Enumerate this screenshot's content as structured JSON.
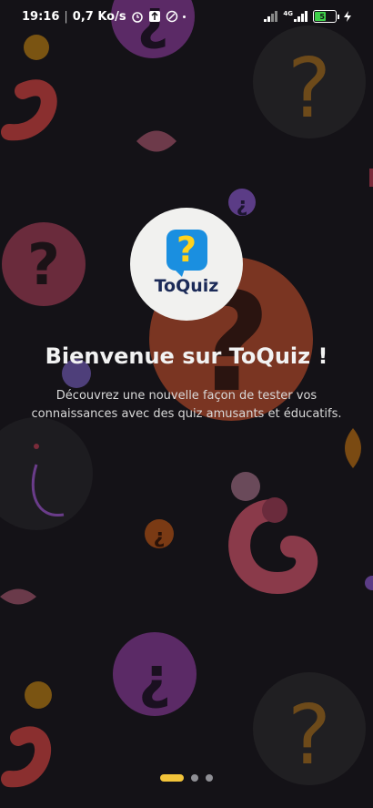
{
  "status_bar": {
    "time": "19:16",
    "speed": "0,7 Ko/s",
    "net_label": "4G",
    "battery": "51"
  },
  "logo": {
    "name": "ToQuiz",
    "symbol": "?"
  },
  "onboarding": {
    "title": "Bienvenue sur ToQuiz !",
    "subtitle": "Découvrez une nouvelle façon de tester vos connaissances avec des quiz amusants et éducatifs."
  },
  "pager": {
    "pages": 3,
    "current": 1
  },
  "colors": {
    "accent": "#f2c33a",
    "brand_blue": "#1a8fe0",
    "background": "#141217"
  }
}
